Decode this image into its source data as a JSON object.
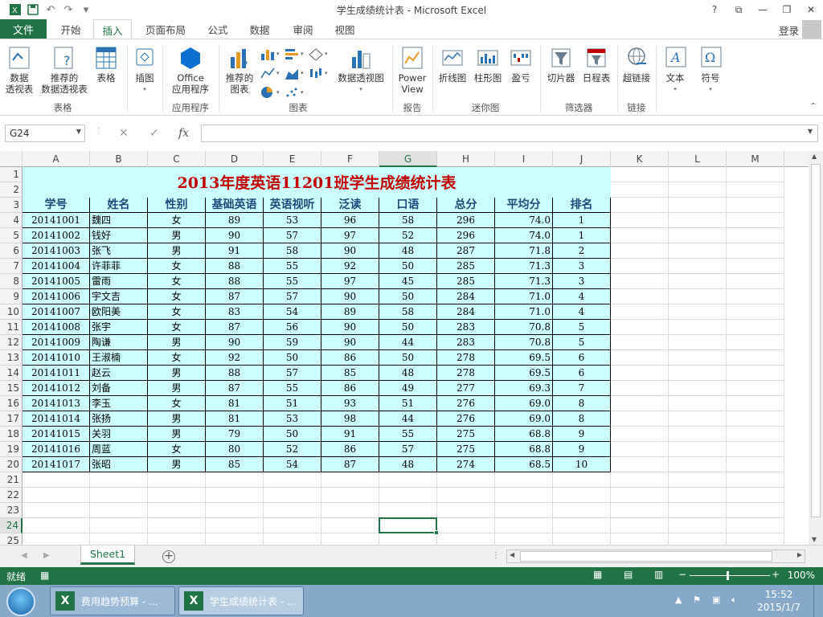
{
  "window": {
    "title": "学生成绩统计表 - Microsoft Excel",
    "help": "?",
    "login": "登录"
  },
  "ribbon_tabs": [
    "文件",
    "开始",
    "插入",
    "页面布局",
    "公式",
    "数据",
    "审阅",
    "视图"
  ],
  "ribbon": {
    "buttons": {
      "pivot": "数据\n透视表",
      "rec_pivot": "推荐的\n数据透视表",
      "table": "表格",
      "illus": "插图",
      "office_apps": "Office\n应用程序",
      "rec_charts": "推荐的\n图表",
      "pivot_chart": "数据透视图",
      "power_view": "Power\nView",
      "line": "折线图",
      "column": "柱形图",
      "winloss": "盈亏",
      "slicer": "切片器",
      "timeline": "日程表",
      "hyperlink": "超链接",
      "text": "文本",
      "symbol": "符号"
    },
    "groups": {
      "tables": "表格",
      "apps": "应用程序",
      "charts": "图表",
      "reports": "报告",
      "sparklines": "迷你图",
      "filters": "筛选器",
      "links": "链接"
    }
  },
  "formula_bar": {
    "name_box": "G24",
    "formula": ""
  },
  "columns": [
    "A",
    "B",
    "C",
    "D",
    "E",
    "F",
    "G",
    "H",
    "I",
    "J",
    "K",
    "L",
    "M"
  ],
  "rows": [
    "1",
    "2",
    "3",
    "4",
    "5",
    "6",
    "7",
    "8",
    "9",
    "10",
    "11",
    "12",
    "13",
    "14",
    "15",
    "16",
    "17",
    "18",
    "19",
    "20",
    "21",
    "22",
    "23",
    "24",
    "25"
  ],
  "sheet": {
    "title": "2013年度英语11201班学生成绩统计表",
    "headers": [
      "学号",
      "姓名",
      "性别",
      "基础英语",
      "英语视听",
      "泛读",
      "口语",
      "总分",
      "平均分",
      "排名"
    ],
    "data": [
      [
        "20141001",
        "魏四",
        "女",
        "89",
        "53",
        "96",
        "58",
        "296",
        "74.0",
        "1"
      ],
      [
        "20141002",
        "钱好",
        "男",
        "90",
        "57",
        "97",
        "52",
        "296",
        "74.0",
        "1"
      ],
      [
        "20141003",
        "张飞",
        "男",
        "91",
        "58",
        "90",
        "48",
        "287",
        "71.8",
        "2"
      ],
      [
        "20141004",
        "许菲菲",
        "女",
        "88",
        "55",
        "92",
        "50",
        "285",
        "71.3",
        "3"
      ],
      [
        "20141005",
        "雷雨",
        "女",
        "88",
        "55",
        "97",
        "45",
        "285",
        "71.3",
        "3"
      ],
      [
        "20141006",
        "宇文吉",
        "女",
        "87",
        "57",
        "90",
        "50",
        "284",
        "71.0",
        "4"
      ],
      [
        "20141007",
        "欧阳美",
        "女",
        "83",
        "54",
        "89",
        "58",
        "284",
        "71.0",
        "4"
      ],
      [
        "20141008",
        "张宇",
        "女",
        "87",
        "56",
        "90",
        "50",
        "283",
        "70.8",
        "5"
      ],
      [
        "20141009",
        "陶谦",
        "男",
        "90",
        "59",
        "90",
        "44",
        "283",
        "70.8",
        "5"
      ],
      [
        "20141010",
        "王淑楠",
        "女",
        "92",
        "50",
        "86",
        "50",
        "278",
        "69.5",
        "6"
      ],
      [
        "20141011",
        "赵云",
        "男",
        "88",
        "57",
        "85",
        "48",
        "278",
        "69.5",
        "6"
      ],
      [
        "20141012",
        "刘备",
        "男",
        "87",
        "55",
        "86",
        "49",
        "277",
        "69.3",
        "7"
      ],
      [
        "20141013",
        "李玉",
        "女",
        "81",
        "51",
        "93",
        "51",
        "276",
        "69.0",
        "8"
      ],
      [
        "20141014",
        "张扬",
        "男",
        "81",
        "53",
        "98",
        "44",
        "276",
        "69.0",
        "8"
      ],
      [
        "20141015",
        "关羽",
        "男",
        "79",
        "50",
        "91",
        "55",
        "275",
        "68.8",
        "9"
      ],
      [
        "20141016",
        "周蓝",
        "女",
        "80",
        "52",
        "86",
        "57",
        "275",
        "68.8",
        "9"
      ],
      [
        "20141017",
        "张昭",
        "男",
        "85",
        "54",
        "87",
        "48",
        "274",
        "68.5",
        "10"
      ]
    ]
  },
  "sheet_tabs": [
    "Sheet1"
  ],
  "status": {
    "ready": "就绪",
    "zoom": "100%"
  },
  "taskbar": {
    "items": [
      "费用趋势预算 - ...",
      "学生成绩统计表 - ..."
    ],
    "time": "15:52",
    "date": "2015/1/7"
  },
  "colors": {
    "excel_green": "#217346",
    "table_fill": "#ccffff",
    "title_red": "#c00000",
    "header_blue": "#1f497d"
  }
}
